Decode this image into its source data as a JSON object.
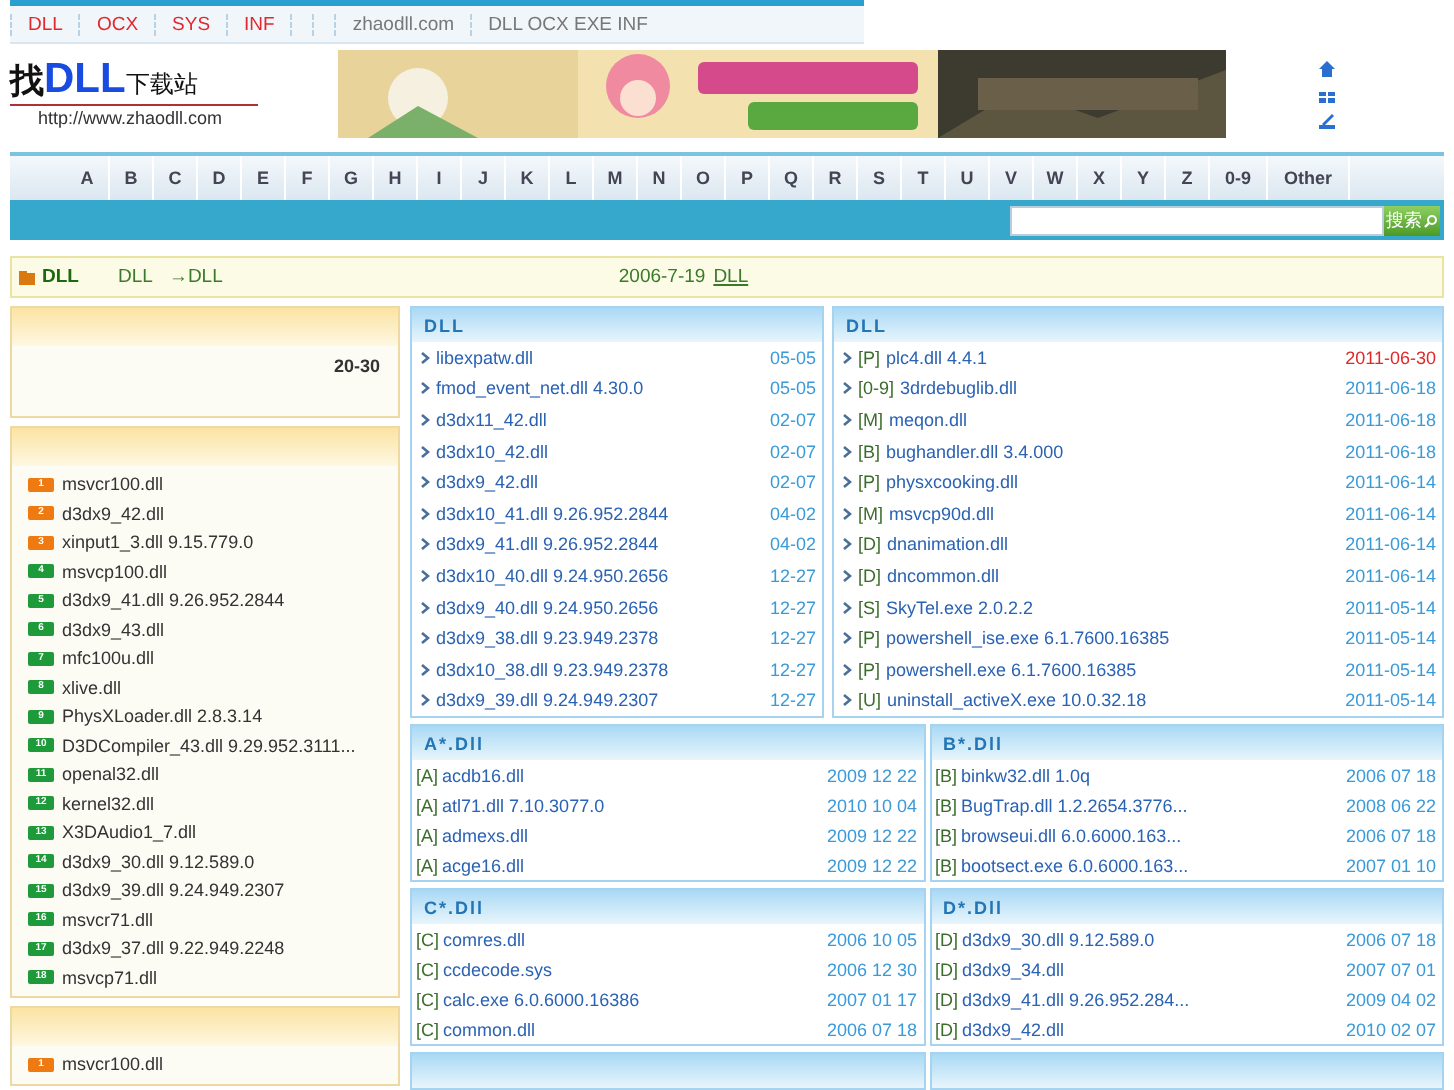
{
  "top_nav": {
    "links": [
      "DLL",
      "OCX",
      "SYS",
      "INF"
    ],
    "site": "zhaodll.com",
    "tagline": "DLL OCX EXE INF"
  },
  "logo": {
    "prefix": "找",
    "main": "DLL",
    "suffix": "下载站",
    "url": "http://www.zhaodll.com"
  },
  "alphabet": [
    "A",
    "B",
    "C",
    "D",
    "E",
    "F",
    "G",
    "H",
    "I",
    "J",
    "K",
    "L",
    "M",
    "N",
    "O",
    "P",
    "Q",
    "R",
    "S",
    "T",
    "U",
    "V",
    "W",
    "X",
    "Y",
    "Z",
    "0-9",
    "Other"
  ],
  "search": {
    "button": "搜索"
  },
  "breadcrumb": {
    "title": "DLL",
    "path": [
      "DLL",
      "→DLL"
    ],
    "date": "2006-7-19",
    "link": "DLL"
  },
  "sidebar": [
    {
      "kind": "range",
      "text": "20-30"
    },
    {
      "kind": "ranking",
      "items": [
        {
          "rank": "1",
          "name": "msvcr100.dll",
          "color": "#f07a12"
        },
        {
          "rank": "2",
          "name": "d3dx9_42.dll",
          "color": "#f07a12"
        },
        {
          "rank": "3",
          "name": "xinput1_3.dll 9.15.779.0",
          "color": "#f07a12"
        },
        {
          "rank": "4",
          "name": "msvcp100.dll",
          "color": "#1f9a3a"
        },
        {
          "rank": "5",
          "name": "d3dx9_41.dll 9.26.952.2844",
          "color": "#1f9a3a"
        },
        {
          "rank": "6",
          "name": "d3dx9_43.dll",
          "color": "#1f9a3a"
        },
        {
          "rank": "7",
          "name": "mfc100u.dll",
          "color": "#1f9a3a"
        },
        {
          "rank": "8",
          "name": "xlive.dll",
          "color": "#1f9a3a"
        },
        {
          "rank": "9",
          "name": "PhysXLoader.dll 2.8.3.14",
          "color": "#1f9a3a"
        },
        {
          "rank": "10",
          "name": "D3DCompiler_43.dll 9.29.952.3111...",
          "color": "#1f9a3a"
        },
        {
          "rank": "11",
          "name": "openal32.dll",
          "color": "#1f9a3a"
        },
        {
          "rank": "12",
          "name": "kernel32.dll",
          "color": "#1f9a3a"
        },
        {
          "rank": "13",
          "name": "X3DAudio1_7.dll",
          "color": "#1f9a3a"
        },
        {
          "rank": "14",
          "name": "d3dx9_30.dll 9.12.589.0",
          "color": "#1f9a3a"
        },
        {
          "rank": "15",
          "name": "d3dx9_39.dll 9.24.949.2307",
          "color": "#1f9a3a"
        },
        {
          "rank": "16",
          "name": "msvcr71.dll",
          "color": "#1f9a3a"
        },
        {
          "rank": "17",
          "name": "d3dx9_37.dll 9.22.949.2248",
          "color": "#1f9a3a"
        },
        {
          "rank": "18",
          "name": "msvcp71.dll",
          "color": "#1f9a3a"
        }
      ]
    },
    {
      "kind": "ranking",
      "items": [
        {
          "rank": "1",
          "name": "msvcr100.dll",
          "color": "#f07a12"
        }
      ]
    }
  ],
  "latest": {
    "title": "DLL",
    "items": [
      {
        "name": "libexpatw.dll",
        "date": "05-05"
      },
      {
        "name": "fmod_event_net.dll 4.30.0",
        "date": "05-05"
      },
      {
        "name": "d3dx11_42.dll",
        "date": "02-07"
      },
      {
        "name": "d3dx10_42.dll",
        "date": "02-07"
      },
      {
        "name": "d3dx9_42.dll",
        "date": "02-07"
      },
      {
        "name": "d3dx10_41.dll 9.26.952.2844",
        "date": "04-02"
      },
      {
        "name": "d3dx9_41.dll 9.26.952.2844",
        "date": "04-02"
      },
      {
        "name": "d3dx10_40.dll 9.24.950.2656",
        "date": "12-27"
      },
      {
        "name": "d3dx9_40.dll 9.24.950.2656",
        "date": "12-27"
      },
      {
        "name": "d3dx9_38.dll 9.23.949.2378",
        "date": "12-27"
      },
      {
        "name": "d3dx10_38.dll 9.23.949.2378",
        "date": "12-27"
      },
      {
        "name": "d3dx9_39.dll 9.24.949.2307",
        "date": "12-27"
      }
    ]
  },
  "updates": {
    "title": "DLL",
    "items": [
      {
        "letter": "[P]",
        "name": "plc4.dll 4.4.1",
        "date": "2011-06-30",
        "highlighted": true
      },
      {
        "letter": "[0-9]",
        "name": "3drdebuglib.dll",
        "date": "2011-06-18",
        "highlighted": false
      },
      {
        "letter": "[M]",
        "name": "meqon.dll",
        "date": "2011-06-18",
        "highlighted": false
      },
      {
        "letter": "[B]",
        "name": "bughandler.dll 3.4.000",
        "date": "2011-06-18",
        "highlighted": false
      },
      {
        "letter": "[P]",
        "name": "physxcooking.dll",
        "date": "2011-06-14",
        "highlighted": false
      },
      {
        "letter": "[M]",
        "name": "msvcp90d.dll",
        "date": "2011-06-14",
        "highlighted": false
      },
      {
        "letter": "[D]",
        "name": "dnanimation.dll",
        "date": "2011-06-14",
        "highlighted": false
      },
      {
        "letter": "[D]",
        "name": "dncommon.dll",
        "date": "2011-06-14",
        "highlighted": false
      },
      {
        "letter": "[S]",
        "name": "SkyTel.exe 2.0.2.2",
        "date": "2011-05-14",
        "highlighted": false
      },
      {
        "letter": "[P]",
        "name": "powershell_ise.exe 6.1.7600.16385",
        "date": "2011-05-14",
        "highlighted": false
      },
      {
        "letter": "[P]",
        "name": "powershell.exe 6.1.7600.16385",
        "date": "2011-05-14",
        "highlighted": false
      },
      {
        "letter": "[U]",
        "name": "uninstall_activeX.exe 10.0.32.18",
        "date": "2011-05-14",
        "highlighted": false
      }
    ]
  },
  "letter_cards": [
    {
      "title": "A*.Dll",
      "items": [
        {
          "letter": "[A]",
          "name": "acdb16.dll",
          "date": "2009 12 22"
        },
        {
          "letter": "[A]",
          "name": "atl71.dll 7.10.3077.0",
          "date": "2010 10 04"
        },
        {
          "letter": "[A]",
          "name": "admexs.dll",
          "date": "2009 12 22"
        },
        {
          "letter": "[A]",
          "name": "acge16.dll",
          "date": "2009 12 22"
        }
      ]
    },
    {
      "title": "B*.Dll",
      "items": [
        {
          "letter": "[B]",
          "name": "binkw32.dll 1.0q",
          "date": "2006 07 18"
        },
        {
          "letter": "[B]",
          "name": "BugTrap.dll 1.2.2654.3776...",
          "date": "2008 06 22"
        },
        {
          "letter": "[B]",
          "name": "browseui.dll 6.0.6000.163...",
          "date": "2006 07 18"
        },
        {
          "letter": "[B]",
          "name": "bootsect.exe 6.0.6000.163...",
          "date": "2007 01 10"
        }
      ]
    },
    {
      "title": "C*.Dll",
      "items": [
        {
          "letter": "[C]",
          "name": "comres.dll",
          "date": "2006 10 05"
        },
        {
          "letter": "[C]",
          "name": "ccdecode.sys",
          "date": "2006 12 30"
        },
        {
          "letter": "[C]",
          "name": "calc.exe 6.0.6000.16386",
          "date": "2007 01 17"
        },
        {
          "letter": "[C]",
          "name": "common.dll",
          "date": "2006 07 18"
        }
      ]
    },
    {
      "title": "D*.Dll",
      "items": [
        {
          "letter": "[D]",
          "name": "d3dx9_30.dll 9.12.589.0",
          "date": "2006 07 18"
        },
        {
          "letter": "[D]",
          "name": "d3dx9_34.dll",
          "date": "2007 07 01"
        },
        {
          "letter": "[D]",
          "name": "d3dx9_41.dll 9.26.952.284...",
          "date": "2009 04 02"
        },
        {
          "letter": "[D]",
          "name": "d3dx9_42.dll",
          "date": "2010 02 07"
        }
      ]
    }
  ]
}
